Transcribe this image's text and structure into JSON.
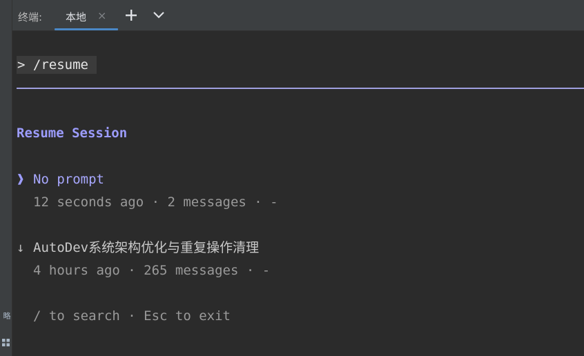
{
  "tool_window": {
    "side_label": "略"
  },
  "tabbar": {
    "title": "终端:",
    "active_tab": {
      "label": "本地",
      "close_glyph": "×"
    },
    "add_icon": "plus-icon",
    "dropdown_icon": "chevron-down-icon"
  },
  "terminal": {
    "prompt": "> /resume",
    "heading": "Resume Session",
    "sessions": [
      {
        "marker": "❱",
        "title": "No prompt",
        "meta": "12 seconds ago · 2 messages · -"
      },
      {
        "marker": "↓",
        "title": "AutoDev系统架构优化与重复操作清理",
        "meta": "4 hours ago · 265 messages · -"
      }
    ],
    "hint": "/ to search · Esc to exit"
  },
  "colors": {
    "background": "#2b2b2b",
    "accent": "#9d9dff",
    "tab_underline": "#4a88c7"
  }
}
